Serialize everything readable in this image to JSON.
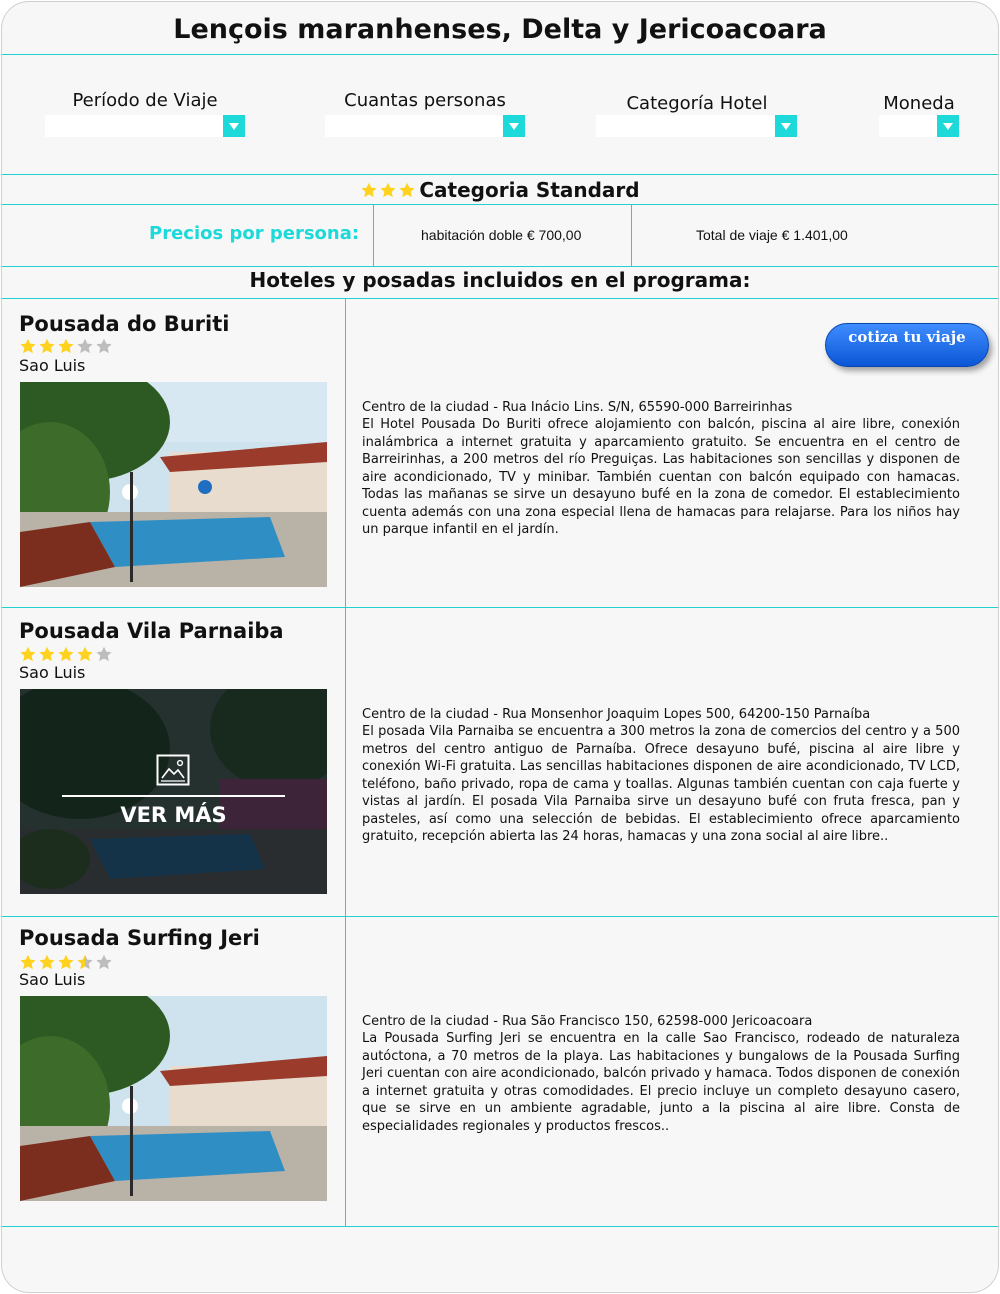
{
  "page": {
    "title": "Lençois maranhenses, Delta y Jericoacoara"
  },
  "filters": {
    "period_label": "Período de Viaje",
    "persons_label": "Cuantas personas",
    "category_label": "Categoría Hotel",
    "currency_label": "Moneda"
  },
  "category": {
    "title": "Categoria Standard",
    "stars": 3
  },
  "prices": {
    "label": "Precios por persona:",
    "double_room": "habitación doble € 700,00",
    "total": "Total de viaje € 1.401,00"
  },
  "hotels_heading": "Hoteles y posadas incluidos en el programa:",
  "cta_label": "cotiza tu viaje",
  "hotels": [
    {
      "name": "Pousada do Buriti",
      "rating": 3,
      "city": "Sao Luis",
      "address": "Centro de la ciudad - Rua Inácio Lins. S/N, 65590-000 Barreirinhas",
      "description": "El Hotel Pousada Do Buriti ofrece alojamiento con balcón, piscina al aire libre, conexión inalámbrica a internet gratuita y aparcamiento gratuito. Se encuentra en el centro de Barreirinhas, a 200 metros del río Preguiças. Las habitaciones son sencillas y disponen de aire acondicionado, TV y minibar. También cuentan con balcón equipado con hamacas. Todas las mañanas se sirve un desayuno bufé en la zona de comedor. El establecimiento cuenta además con una zona especial llena de hamacas para relajarse. Para los niños hay un parque infantil en el jardín."
    },
    {
      "name": "Pousada Vila Parnaiba",
      "rating": 4,
      "city": "Sao Luis",
      "overlay_label": "VER MÁS",
      "address": "Centro de la ciudad - Rua Monsenhor Joaquim Lopes 500, 64200-150 Parnaíba",
      "description": "El posada Vila Parnaiba se encuentra a 300 metros la zona de comercios del centro y a 500 metros del centro antiguo de Parnaíba. Ofrece desayuno bufé, piscina al aire libre y conexión Wi-Fi gratuita. Las sencillas habitaciones disponen de aire acondicionado, TV LCD, teléfono, baño privado, ropa de cama y toallas. Algunas también cuentan con caja fuerte y vistas al jardín. El posada Vila Parnaiba sirve un desayuno bufé con fruta fresca, pan y pasteles, así como una selección de bebidas. El establecimiento ofrece aparcamiento gratuito, recepción abierta las 24 horas, hamacas y una zona social al aire libre.."
    },
    {
      "name": "Pousada Surfing Jeri",
      "rating": 3.5,
      "city": "Sao Luis",
      "address": "Centro de la ciudad - Rua São Francisco 150, 62598-000 Jericoacoara",
      "description": "La Pousada Surfing Jeri se encuentra en la calle Sao Francisco, rodeado de naturaleza autóctona, a 70 metros de la playa. Las habitaciones y bungalows de la Pousada Surfing Jeri cuentan con aire acondicionado, balcón privado y hamaca. Todos disponen de conexión a internet gratuita y otras comodidades. El precio incluye un completo desayuno casero, que se sirve en un ambiente agradable, junto a la piscina al aire libre. Consta de especialidades regionales y productos frescos.."
    }
  ],
  "colors": {
    "accent": "#1ed9d9",
    "star_on": "#ffd21f",
    "star_off": "#bdbdbd",
    "cta": "#1763e6"
  }
}
